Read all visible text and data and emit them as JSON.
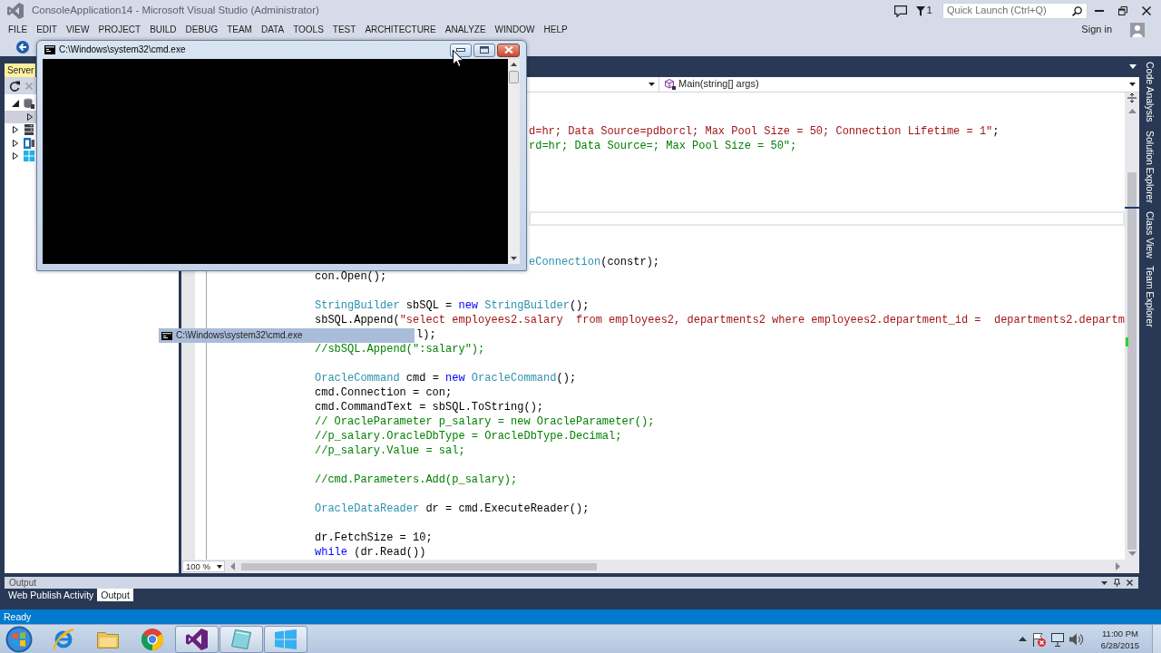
{
  "window": {
    "title": "ConsoleApplication14 - Microsoft Visual Studio (Administrator)",
    "notification_count": "1",
    "quick_launch": {
      "placeholder": "Quick Launch (Ctrl+Q)"
    },
    "sign_in": "Sign in"
  },
  "menu": [
    "FILE",
    "EDIT",
    "VIEW",
    "PROJECT",
    "BUILD",
    "DEBUG",
    "TEAM",
    "DATA",
    "TOOLS",
    "TEST",
    "ARCHITECTURE",
    "ANALYZE",
    "WINDOW",
    "HELP"
  ],
  "server_explorer": {
    "tab": "Server",
    "nodes": [
      {
        "kind": "connections",
        "expanded": true,
        "selected": false,
        "children": [
          {
            "expanded": false,
            "selected": true
          }
        ]
      },
      {
        "kind": "servers",
        "expanded": false,
        "selected": false
      },
      {
        "kind": "sql",
        "expanded": false,
        "selected": false
      },
      {
        "kind": "cloud",
        "expanded": false,
        "selected": false
      }
    ]
  },
  "editor": {
    "member": "Main(string[] args)",
    "zoom": "100 %",
    "lines": [
      {
        "current": false,
        "tokens": [
          {
            "kind": "string",
            "text": "d=hr; Data Source=pdborcl; Max Pool Size = 50; Connection Lifetime = 1\""
          },
          {
            "kind": "plain",
            "text": ";"
          }
        ]
      },
      {
        "current": false,
        "tokens": [
          {
            "kind": "comment",
            "text": "rd=hr; Data Source=; Max Pool Size = 50\";"
          }
        ]
      },
      {
        "current": false
      },
      {
        "current": false
      },
      {
        "current": false
      },
      {
        "current": false
      },
      {
        "current": true
      },
      {
        "current": false
      },
      {
        "current": false
      },
      {
        "current": false,
        "tokens": [
          {
            "kind": "type",
            "text": "eConnection"
          },
          {
            "kind": "plain",
            "text": "(constr);"
          }
        ]
      },
      {
        "current": false,
        "tokens": [
          {
            "kind": "plain",
            "text": "con.Open();"
          }
        ]
      },
      {
        "current": false
      },
      {
        "current": false,
        "tokens": [
          {
            "kind": "type",
            "text": "StringBuilder"
          },
          {
            "kind": "plain",
            "text": " sbSQL = "
          },
          {
            "kind": "keyword",
            "text": "new "
          },
          {
            "kind": "type",
            "text": "StringBuilder"
          },
          {
            "kind": "plain",
            "text": "();"
          }
        ]
      },
      {
        "current": false,
        "tokens": [
          {
            "kind": "plain",
            "text": "sbSQL.Append("
          },
          {
            "kind": "string",
            "text": "\"select employees2.salary  from employees2, departments2 where employees2.department_id =  departments2.departm"
          }
        ]
      },
      {
        "current": false,
        "tokens": [
          {
            "kind": "plain",
            "text": "l);"
          }
        ]
      },
      {
        "current": false,
        "tokens": [
          {
            "kind": "comment",
            "text": "//sbSQL.Append(\":salary\");"
          }
        ]
      },
      {
        "current": false
      },
      {
        "current": false,
        "tokens": [
          {
            "kind": "type",
            "text": "OracleCommand"
          },
          {
            "kind": "plain",
            "text": " cmd = "
          },
          {
            "kind": "keyword",
            "text": "new "
          },
          {
            "kind": "type",
            "text": "OracleCommand"
          },
          {
            "kind": "plain",
            "text": "();"
          }
        ]
      },
      {
        "current": false,
        "tokens": [
          {
            "kind": "plain",
            "text": "cmd.Connection = con;"
          }
        ]
      },
      {
        "current": false,
        "tokens": [
          {
            "kind": "plain",
            "text": "cmd.CommandText = sbSQL.ToString();"
          }
        ]
      },
      {
        "current": false,
        "tokens": [
          {
            "kind": "comment",
            "text": "// OracleParameter p_salary = new OracleParameter();"
          }
        ]
      },
      {
        "current": false,
        "tokens": [
          {
            "kind": "comment",
            "text": "//p_salary.OracleDbType = OracleDbType.Decimal;"
          }
        ]
      },
      {
        "current": false,
        "tokens": [
          {
            "kind": "comment",
            "text": "//p_salary.Value = sal;"
          }
        ]
      },
      {
        "current": false
      },
      {
        "current": false,
        "tokens": [
          {
            "kind": "comment",
            "text": "//cmd.Parameters.Add(p_salary);"
          }
        ]
      },
      {
        "current": false
      },
      {
        "current": false,
        "tokens": [
          {
            "kind": "type",
            "text": "OracleDataReader"
          },
          {
            "kind": "plain",
            "text": " dr = cmd.ExecuteReader();"
          }
        ]
      },
      {
        "current": false
      },
      {
        "current": false,
        "tokens": [
          {
            "kind": "plain",
            "text": "dr.FetchSize = 10;"
          }
        ]
      },
      {
        "current": false,
        "tokens": [
          {
            "kind": "keyword",
            "text": "while"
          },
          {
            "kind": "plain",
            "text": " (dr.Read())"
          }
        ]
      }
    ]
  },
  "side_tabs": [
    "Code Analysis",
    "Solution Explorer",
    "Class View",
    "Team Explorer"
  ],
  "output": {
    "title": "Output",
    "tabs": [
      {
        "label": "Web Publish Activity",
        "selected": false
      },
      {
        "label": "Output",
        "selected": true
      }
    ]
  },
  "status_bar": {
    "text": "Ready"
  },
  "console_window": {
    "title": "C:\\Windows\\system32\\cmd.exe"
  },
  "window_tooltip": {
    "text": "C:\\Windows\\system32\\cmd.exe"
  },
  "taskbar": {
    "items": [
      {
        "kind": "ie",
        "running": false
      },
      {
        "kind": "folder",
        "running": false
      },
      {
        "kind": "chrome",
        "running": false
      },
      {
        "kind": "vs",
        "running": true
      },
      {
        "kind": "slate",
        "running": true
      },
      {
        "kind": "windows",
        "running": true
      }
    ],
    "clock": {
      "time": "11:00 PM",
      "date": "6/28/2015"
    }
  }
}
